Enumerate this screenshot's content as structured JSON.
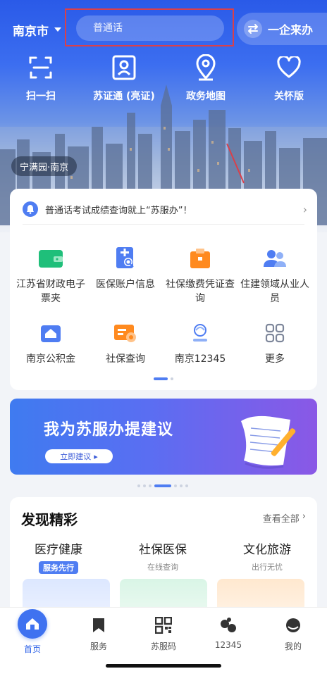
{
  "header": {
    "city": "南京市",
    "search_placeholder": "普通话",
    "qiye_label": "一企来办"
  },
  "quick_actions": [
    {
      "label": "扫一扫",
      "icon": "scan-icon"
    },
    {
      "label": "苏证通 (亮证)",
      "icon": "id-card-icon"
    },
    {
      "label": "政务地图",
      "icon": "map-pin-icon"
    },
    {
      "label": "关怀版",
      "icon": "heart-icon"
    }
  ],
  "location_tag": "宁满园·南京",
  "notice": {
    "text": "普通话考试成绩查询就上“苏服办”！"
  },
  "services": [
    {
      "label": "江苏省财政电子票夹",
      "icon": "wallet-icon",
      "color": "#1fbf7a"
    },
    {
      "label": "医保账户信息",
      "icon": "medical-account-icon",
      "color": "#4f7df2"
    },
    {
      "label": "社保缴费凭证查询",
      "icon": "folder-icon",
      "color": "#ff8a1f"
    },
    {
      "label": "住建领域从业人员",
      "icon": "people-icon",
      "color": "#4f7df2"
    },
    {
      "label": "南京公积金",
      "icon": "house-fund-icon",
      "color": "#4f7df2"
    },
    {
      "label": "社保查询",
      "icon": "social-security-card-icon",
      "color": "#ff8a1f"
    },
    {
      "label": "南京12345",
      "icon": "hotline-icon",
      "color": "#4f7df2"
    },
    {
      "label": "更多",
      "icon": "grid-icon",
      "color": "#8a93a6"
    }
  ],
  "banner": {
    "title": "我为苏服办提建议",
    "button": "立即建议"
  },
  "discover": {
    "title": "发现精彩",
    "more": "查看全部",
    "columns": [
      {
        "name": "医疗健康",
        "sub": "服务先行"
      },
      {
        "name": "社保医保",
        "sub": "在线查询"
      },
      {
        "name": "文化旅游",
        "sub": "出行无忧"
      }
    ]
  },
  "tabs": [
    {
      "label": "首页",
      "icon": "home-icon"
    },
    {
      "label": "服务",
      "icon": "bookmark-icon"
    },
    {
      "label": "苏服码",
      "icon": "qr-code-icon"
    },
    {
      "label": "12345",
      "icon": "chat-bubbles-icon"
    },
    {
      "label": "我的",
      "icon": "user-icon"
    }
  ],
  "colors": {
    "brand_blue": "#3f72f0",
    "highlight_red": "#d9404a",
    "orange": "#ff8a1f",
    "green": "#1fbf7a"
  }
}
